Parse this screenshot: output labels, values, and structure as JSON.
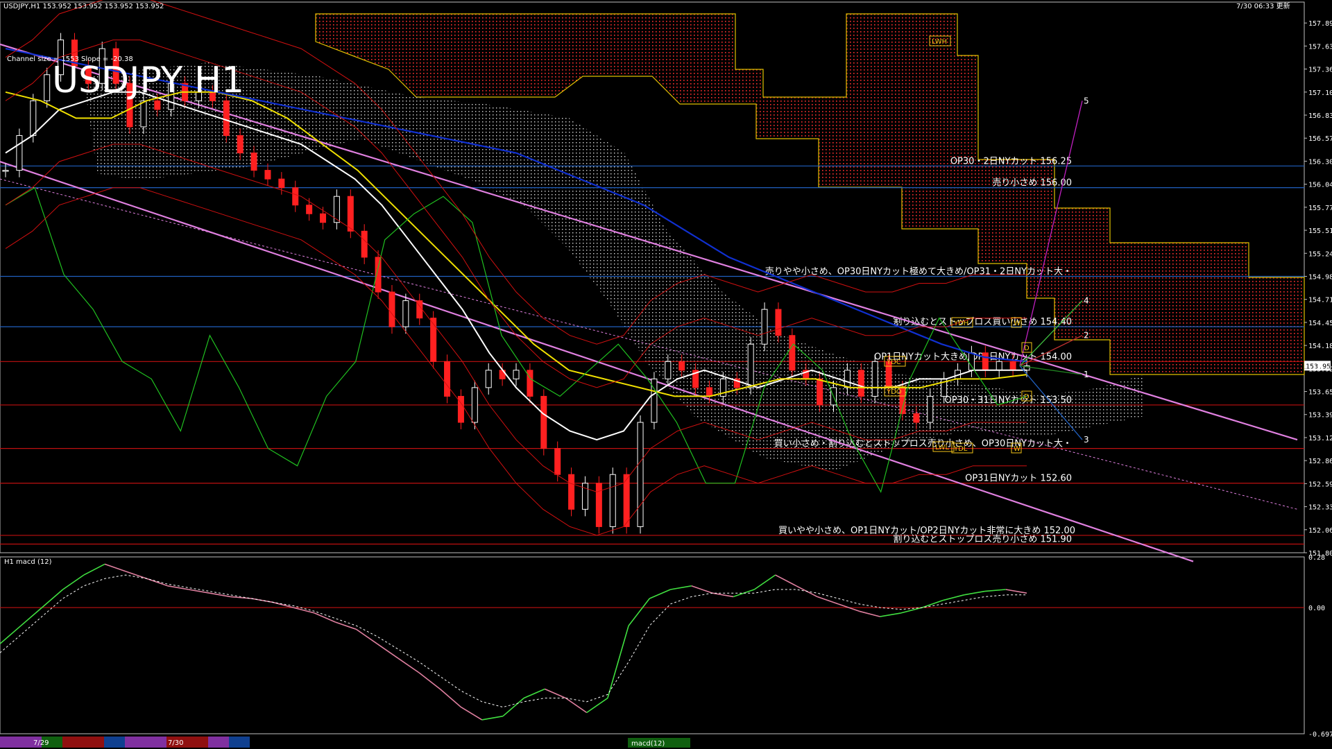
{
  "header": {
    "symbol_line": "USDJPY,H1  153.952 153.952 153.952 153.952",
    "timestamp": "7/30 06:33 更新",
    "channel_info": "Channel size = 1553 Slope = -20.38",
    "chart_title": "USDJPY H1",
    "current_price_box": "153.952",
    "sub_panel_label": "H1  macd (12)",
    "sub_legend": "macd(12)"
  },
  "colors": {
    "background": "#000000",
    "bull_candle": "#ffffff",
    "bear_candle": "#ff2020",
    "kumo_bear": "#ff3030",
    "kumo_bull": "#ffffff",
    "ma_white": "#ffffff",
    "ma_yellow": "#f0e000",
    "ma_blue": "#1030d0",
    "bollinger": "#d01010",
    "chikou": "#20c020",
    "channel": "#e080e0",
    "level_blue": "#2060c0",
    "level_red": "#c01010",
    "macd_up": "#40e040",
    "macd_down": "#e080a0"
  },
  "chart_data": [
    {
      "type": "candlestick",
      "title": "USDJPY H1",
      "ylim": [
        151.8,
        158.0
      ],
      "y_ticks": [
        "157.895",
        "157.630",
        "157.365",
        "157.100",
        "156.835",
        "156.570",
        "156.305",
        "156.040",
        "155.775",
        "155.510",
        "155.245",
        "154.980",
        "154.715",
        "154.450",
        "154.185",
        "153.920",
        "153.655",
        "153.390",
        "153.125",
        "152.860",
        "152.595",
        "152.330",
        "152.065",
        "151.800"
      ],
      "x_ticks": [
        "7/29",
        "7/30"
      ],
      "price_path": [
        156.2,
        156.6,
        157.0,
        157.3,
        157.7,
        157.4,
        157.2,
        157.6,
        157.2,
        156.7,
        157.0,
        156.9,
        157.2,
        157.0,
        157.1,
        157.0,
        156.6,
        156.4,
        156.2,
        156.1,
        156.0,
        155.8,
        155.7,
        155.6,
        155.9,
        155.5,
        155.2,
        154.8,
        154.4,
        154.7,
        154.5,
        154.0,
        153.6,
        153.3,
        153.7,
        153.9,
        153.8,
        153.9,
        153.6,
        153.0,
        152.7,
        152.3,
        152.6,
        152.1,
        152.7,
        152.1,
        153.3,
        153.8,
        154.0,
        153.9,
        153.7,
        153.6,
        153.8,
        153.7,
        154.2,
        154.6,
        154.3,
        153.9,
        153.8,
        153.5,
        153.7,
        153.9,
        153.6,
        154.0,
        153.7,
        153.4,
        153.3,
        153.6,
        153.8,
        153.9,
        154.1,
        153.9,
        154.0,
        153.9,
        153.95
      ],
      "series": [
        {
          "name": "MA white",
          "values": [
            156.4,
            156.6,
            156.9,
            157.0,
            157.1,
            157.1,
            157.0,
            156.9,
            156.8,
            156.7,
            156.6,
            156.5,
            156.3,
            156.1,
            155.8,
            155.4,
            155.0,
            154.6,
            154.1,
            153.7,
            153.4,
            153.2,
            153.1,
            153.2,
            153.6,
            153.8,
            153.9,
            153.8,
            153.7,
            153.8,
            153.9,
            153.8,
            153.7,
            153.7,
            153.8,
            153.8,
            153.9,
            153.9,
            153.9
          ]
        },
        {
          "name": "MA yellow",
          "values": [
            157.1,
            157.0,
            156.8,
            156.8,
            157.0,
            157.1,
            157.1,
            157.0,
            156.8,
            156.5,
            156.2,
            155.8,
            155.4,
            155.0,
            154.6,
            154.2,
            153.9,
            153.8,
            153.7,
            153.6,
            153.6,
            153.7,
            153.8,
            153.8,
            153.7,
            153.7,
            153.7,
            153.8,
            153.8,
            153.85
          ]
        },
        {
          "name": "MA blue",
          "values": [
            157.6,
            157.5,
            157.4,
            157.3,
            157.2,
            157.1,
            157.0,
            156.9,
            156.8,
            156.7,
            156.6,
            156.5,
            156.4,
            156.2,
            156.0,
            155.8,
            155.5,
            155.2,
            155.0,
            154.8,
            154.6,
            154.4,
            154.2,
            154.05,
            154.0
          ]
        },
        {
          "name": "Chikou",
          "values": [
            155.8,
            156.0,
            155.0,
            154.6,
            154.0,
            153.8,
            153.2,
            154.3,
            153.7,
            153.0,
            152.8,
            153.6,
            154.0,
            155.4,
            155.7,
            155.9,
            155.6,
            154.3,
            153.8,
            153.6,
            153.9,
            154.2,
            153.8,
            153.3,
            152.6,
            152.6,
            153.7,
            154.2,
            153.9,
            153.1,
            152.5,
            153.8,
            154.5,
            154.0,
            153.5,
            153.6
          ]
        }
      ],
      "channel": {
        "upper": [
          157.65,
          153.1
        ],
        "lower": [
          156.3,
          151.7
        ],
        "mid": [
          156.1,
          152.3
        ]
      },
      "levels": [
        {
          "price": 156.25,
          "label": "OP30・2日NYカット 156.25",
          "color": "blue"
        },
        {
          "price": 156.0,
          "label": "売り小さめ 156.00",
          "color": "blue"
        },
        {
          "price": 154.98,
          "label": "売りやや小さめ、OP30日NYカット極めて大きめ/OP31・2日NYカット大・",
          "color": "blue"
        },
        {
          "price": 154.4,
          "label": "割り込むとストップロス買い小さめ 154.40",
          "color": "blue"
        },
        {
          "price": 154.0,
          "label": "OP1日NYカット大きめ/OP1日NYカット 154.00",
          "color": "red"
        },
        {
          "price": 153.5,
          "label": "OP30・31日NYカット 153.50",
          "color": "red"
        },
        {
          "price": 153.0,
          "label": "買い小さめ・割り込むとストップロス売り小さめ、OP30日NYカット大・",
          "color": "red"
        },
        {
          "price": 152.6,
          "label": "OP31日NYカット 152.60",
          "color": "red"
        },
        {
          "price": 152.0,
          "label": "買いやや小さめ、OP1日NYカット/OP2日NYカット非常に大きめ 152.00",
          "color": "red"
        },
        {
          "price": 151.9,
          "label": "割り込むとストップロス売り小さめ 151.90",
          "color": "red"
        }
      ],
      "tags": [
        "LWH",
        "YDH",
        "YDC",
        "YDO",
        "YDL",
        "LWL",
        "W",
        "W",
        "D",
        "D"
      ],
      "wave_labels": [
        "5",
        "4",
        "2",
        "1",
        "3"
      ]
    },
    {
      "type": "line",
      "title": "macd (12)",
      "ylim": [
        -0.697,
        0.28
      ],
      "y_ticks": [
        "0.28",
        "0.00",
        "-0.697"
      ],
      "series": [
        {
          "name": "macd",
          "values": [
            -0.2,
            -0.1,
            0.0,
            0.1,
            0.18,
            0.24,
            0.2,
            0.16,
            0.12,
            0.1,
            0.08,
            0.06,
            0.05,
            0.03,
            0.0,
            -0.03,
            -0.08,
            -0.12,
            -0.2,
            -0.28,
            -0.36,
            -0.45,
            -0.55,
            -0.62,
            -0.6,
            -0.5,
            -0.45,
            -0.5,
            -0.58,
            -0.5,
            -0.1,
            0.05,
            0.1,
            0.12,
            0.08,
            0.06,
            0.1,
            0.18,
            0.12,
            0.06,
            0.02,
            -0.02,
            -0.05,
            -0.03,
            0.0,
            0.04,
            0.07,
            0.09,
            0.1,
            0.08
          ]
        },
        {
          "name": "signal",
          "values": [
            -0.25,
            -0.15,
            -0.05,
            0.05,
            0.12,
            0.16,
            0.18,
            0.16,
            0.13,
            0.11,
            0.09,
            0.07,
            0.05,
            0.03,
            0.01,
            -0.02,
            -0.06,
            -0.1,
            -0.16,
            -0.23,
            -0.3,
            -0.38,
            -0.46,
            -0.52,
            -0.55,
            -0.52,
            -0.5,
            -0.5,
            -0.52,
            -0.48,
            -0.3,
            -0.1,
            0.02,
            0.06,
            0.08,
            0.08,
            0.08,
            0.1,
            0.1,
            0.08,
            0.05,
            0.02,
            0.0,
            -0.01,
            0.0,
            0.02,
            0.04,
            0.06,
            0.07,
            0.07
          ]
        }
      ]
    }
  ]
}
